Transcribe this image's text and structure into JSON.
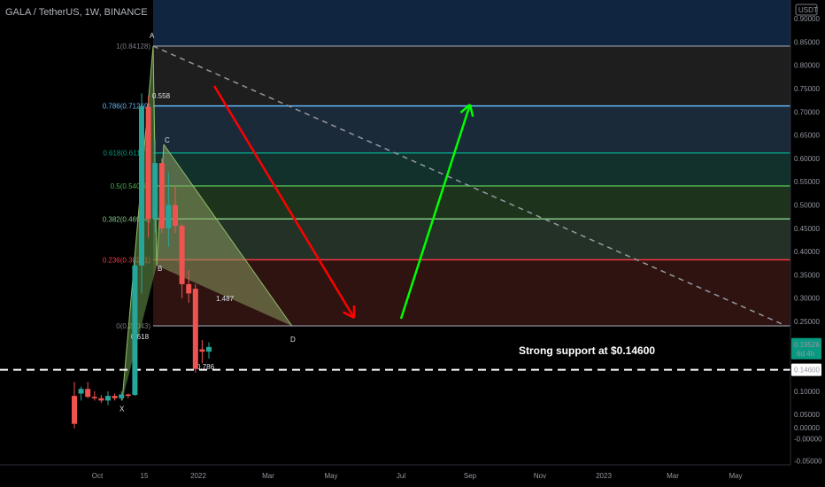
{
  "header": {
    "title": "GALA / TetherUS, 1W, BINANCE"
  },
  "chart_data": {
    "type": "candlestick",
    "symbol": "GALA / TetherUS",
    "interval": "1W",
    "exchange": "BINANCE",
    "currency": "USDT",
    "ylim": [
      -0.05,
      0.9
    ],
    "y_ticks": [
      "0.90000",
      "0.85000",
      "0.80000",
      "0.75000",
      "0.70000",
      "0.65000",
      "0.60000",
      "0.55000",
      "0.50000",
      "0.45000",
      "0.40000",
      "0.35000",
      "0.30000",
      "0.25000",
      "0.20000",
      "0.15000",
      "0.10000",
      "0.05000",
      "0.00000",
      "-0.00000",
      "-0.05000"
    ],
    "x_ticks": [
      "Oct",
      "15",
      "2022",
      "Mar",
      "May",
      "Jul",
      "Sep",
      "Nov",
      "2023",
      "Mar",
      "May"
    ],
    "candles": [
      {
        "o": 0.09,
        "h": 0.12,
        "l": 0.02,
        "c": 0.03
      },
      {
        "o": 0.095,
        "h": 0.11,
        "l": 0.08,
        "c": 0.105
      },
      {
        "o": 0.105,
        "h": 0.12,
        "l": 0.085,
        "c": 0.088
      },
      {
        "o": 0.088,
        "h": 0.1,
        "l": 0.08,
        "c": 0.085
      },
      {
        "o": 0.085,
        "h": 0.092,
        "l": 0.075,
        "c": 0.08
      },
      {
        "o": 0.08,
        "h": 0.1,
        "l": 0.07,
        "c": 0.09
      },
      {
        "o": 0.09,
        "h": 0.095,
        "l": 0.08,
        "c": 0.085
      },
      {
        "o": 0.085,
        "h": 0.1,
        "l": 0.08,
        "c": 0.093
      },
      {
        "o": 0.093,
        "h": 0.095,
        "l": 0.085,
        "c": 0.09
      },
      {
        "o": 0.092,
        "h": 0.385,
        "l": 0.09,
        "c": 0.37
      },
      {
        "o": 0.37,
        "h": 0.74,
        "l": 0.31,
        "c": 0.712
      },
      {
        "o": 0.71,
        "h": 0.735,
        "l": 0.43,
        "c": 0.47
      },
      {
        "o": 0.47,
        "h": 0.64,
        "l": 0.44,
        "c": 0.59
      },
      {
        "o": 0.59,
        "h": 0.6,
        "l": 0.44,
        "c": 0.45
      },
      {
        "o": 0.45,
        "h": 0.57,
        "l": 0.41,
        "c": 0.5
      },
      {
        "o": 0.5,
        "h": 0.54,
        "l": 0.44,
        "c": 0.455
      },
      {
        "o": 0.455,
        "h": 0.46,
        "l": 0.3,
        "c": 0.33
      },
      {
        "o": 0.33,
        "h": 0.36,
        "l": 0.29,
        "c": 0.31
      },
      {
        "o": 0.32,
        "h": 0.33,
        "l": 0.14,
        "c": 0.148
      },
      {
        "o": 0.19,
        "h": 0.21,
        "l": 0.16,
        "c": 0.185
      },
      {
        "o": 0.185,
        "h": 0.205,
        "l": 0.17,
        "c": 0.195
      }
    ],
    "fib_levels": [
      {
        "label": "1(0.84128)",
        "value": 0.84128,
        "color": "#787b86"
      },
      {
        "label": "0.786(0.71269)",
        "value": 0.71269,
        "color": "#64b5f6"
      },
      {
        "label": "0.618(0.61177)",
        "value": 0.61177,
        "color": "#089981"
      },
      {
        "label": "0.5(0.54088)",
        "value": 0.54088,
        "color": "#4caf50"
      },
      {
        "label": "0.382(0.46994)",
        "value": 0.46994,
        "color": "#81c784"
      },
      {
        "label": "0.236(0.38221)",
        "value": 0.38221,
        "color": "#f23645"
      },
      {
        "label": "0(0.24043)",
        "value": 0.24043,
        "color": "#787b86"
      }
    ],
    "pattern_points": [
      {
        "label": "X",
        "value": 0.08
      },
      {
        "label": "A",
        "value": 0.84128
      },
      {
        "label": "B",
        "value": 0.37
      },
      {
        "label": "C",
        "value": 0.63
      },
      {
        "label": "D",
        "value": 0.24
      }
    ],
    "pattern_ratios": [
      "0.618",
      "0.558",
      "1.487",
      "0.786"
    ],
    "support_level": 0.146,
    "annotation": "Strong support at $0.14600",
    "current_price": "0.19526",
    "countdown": "6d 4h",
    "support_label": "0.14600"
  },
  "colors": {
    "bull": "#26a69a",
    "bear": "#ef5350",
    "up_arrow": "#00ff00",
    "down_arrow": "#ff0000"
  }
}
